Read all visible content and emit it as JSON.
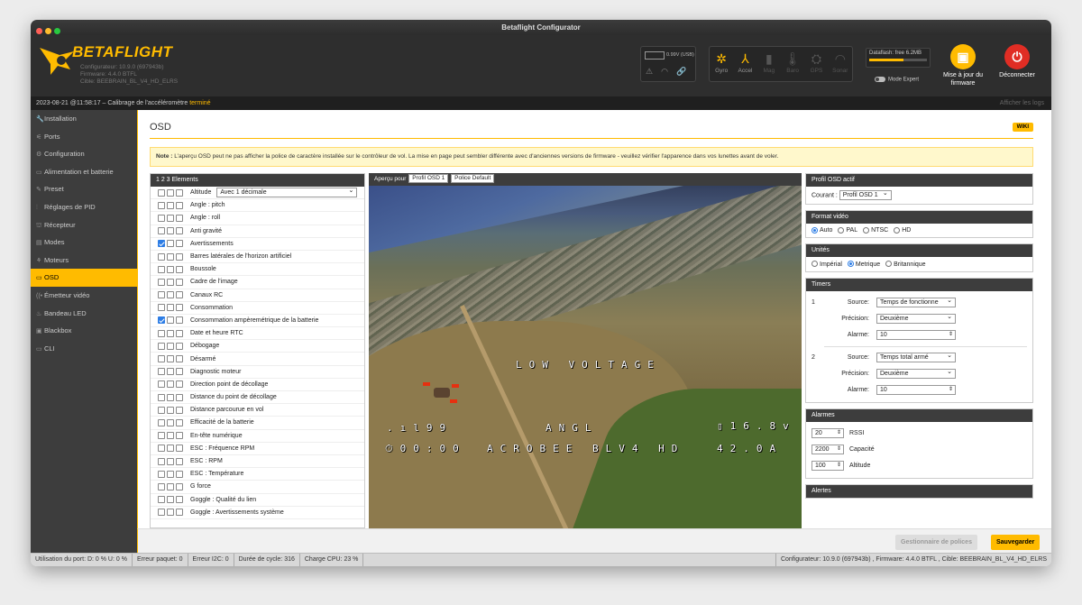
{
  "window": {
    "title": "Betaflight Configurator"
  },
  "header": {
    "logo_text": "BETAFLIGHT",
    "configurator": "Configurateur: 10.9.0 (697943b)",
    "firmware": "Firmware: 4.4.0 BTFL",
    "target": "Cible: BEEBRAIN_BL_V4_HD_ELRS",
    "battery": "0.99V (USB)",
    "sensors": [
      {
        "name": "Gyro",
        "icon": "✲",
        "state": "on"
      },
      {
        "name": "Accel",
        "icon": "⅄",
        "state": "on"
      },
      {
        "name": "Mag",
        "icon": "▮",
        "state": "off"
      },
      {
        "name": "Baro",
        "icon": "🌡",
        "state": "off"
      },
      {
        "name": "GPS",
        "icon": "⛭",
        "state": "off"
      },
      {
        "name": "Sonar",
        "icon": "◠",
        "state": "off"
      }
    ],
    "dataflash": "Dataflash: free 6.2MB",
    "dataflash_used_fraction": 0.6,
    "expert_mode": "Mode Expert",
    "update_firmware": "Mise à jour du firmware",
    "disconnect": "Déconnecter",
    "accent": "#ffbb00",
    "danger": "#e02d24"
  },
  "log": {
    "prefix": "2023-08-21 @11:58:17 – Calibrage de l'accéléromètre ",
    "done": "terminé",
    "show_logs": "Afficher les logs"
  },
  "nav": [
    {
      "label": "Installation",
      "icon": "🔧"
    },
    {
      "label": "Ports",
      "icon": "⚟"
    },
    {
      "label": "Configuration",
      "icon": "⚙"
    },
    {
      "label": "Alimentation et batterie",
      "icon": "▭"
    },
    {
      "label": "Preset",
      "icon": "✎"
    },
    {
      "label": "Réglages de PID",
      "icon": "⫶"
    },
    {
      "label": "Récepteur",
      "icon": "⛫"
    },
    {
      "label": "Modes",
      "icon": "▤"
    },
    {
      "label": "Moteurs",
      "icon": "⚘"
    },
    {
      "label": "OSD",
      "icon": "▭",
      "active": true
    },
    {
      "label": "Émetteur vidéo",
      "icon": "((•"
    },
    {
      "label": "Bandeau LED",
      "icon": "♨"
    },
    {
      "label": "Blackbox",
      "icon": "▣"
    },
    {
      "label": "CLI",
      "icon": "▭"
    }
  ],
  "osd": {
    "title": "OSD",
    "wiki": "WIKI",
    "note_bold": "Note :",
    "note": " L'aperçu OSD peut ne pas afficher la police de caractère installée sur le contrôleur de vol. La mise en page peut sembler différente avec d'anciennes versions de firmware - veuillez vérifier l'apparence dans vos lunettes avant de voler.",
    "elements_header": "1  2  3  Elements",
    "altitude_select": "Avec 1 décimale",
    "elements": [
      {
        "label": "Altitude",
        "c": [
          0,
          0,
          0
        ],
        "select": true
      },
      {
        "label": "Angle : pitch",
        "c": [
          0,
          0,
          0
        ]
      },
      {
        "label": "Angle : roll",
        "c": [
          0,
          0,
          0
        ]
      },
      {
        "label": "Anti gravité",
        "c": [
          0,
          0,
          0
        ]
      },
      {
        "label": "Avertissements",
        "c": [
          1,
          0,
          0
        ]
      },
      {
        "label": "Barres latérales de l'horizon artificiel",
        "c": [
          0,
          0,
          0
        ]
      },
      {
        "label": "Boussole",
        "c": [
          0,
          0,
          0
        ]
      },
      {
        "label": "Cadre de l'image",
        "c": [
          0,
          0,
          0
        ]
      },
      {
        "label": "Canaux RC",
        "c": [
          0,
          0,
          0
        ]
      },
      {
        "label": "Consommation",
        "c": [
          0,
          0,
          0
        ]
      },
      {
        "label": "Consommation ampèremétrique de la batterie",
        "c": [
          1,
          0,
          0
        ]
      },
      {
        "label": "Date et heure RTC",
        "c": [
          0,
          0,
          0
        ]
      },
      {
        "label": "Débogage",
        "c": [
          0,
          0,
          0
        ]
      },
      {
        "label": "Désarmé",
        "c": [
          0,
          0,
          0
        ]
      },
      {
        "label": "Diagnostic moteur",
        "c": [
          0,
          0,
          0
        ]
      },
      {
        "label": "Direction point de décollage",
        "c": [
          0,
          0,
          0
        ]
      },
      {
        "label": "Distance du point de décollage",
        "c": [
          0,
          0,
          0
        ]
      },
      {
        "label": "Distance parcourue en vol",
        "c": [
          0,
          0,
          0
        ]
      },
      {
        "label": "Efficacité de la batterie",
        "c": [
          0,
          0,
          0
        ]
      },
      {
        "label": "En-tête numérique",
        "c": [
          0,
          0,
          0
        ]
      },
      {
        "label": "ESC : Fréquence RPM",
        "c": [
          0,
          0,
          0
        ]
      },
      {
        "label": "ESC : RPM",
        "c": [
          0,
          0,
          0
        ]
      },
      {
        "label": "ESC : Température",
        "c": [
          0,
          0,
          0
        ]
      },
      {
        "label": "G force",
        "c": [
          0,
          0,
          0
        ]
      },
      {
        "label": "Goggle : Qualité du lien",
        "c": [
          0,
          0,
          0
        ]
      },
      {
        "label": "Goggle : Avertissements système",
        "c": [
          0,
          0,
          0
        ]
      }
    ],
    "preview_label": "Aperçu pour",
    "preview_profile": "Profil OSD 1",
    "preview_font": "Police Default",
    "overlay": {
      "warning": "LOW VOLTAGE",
      "rssi": "99",
      "angle": "ANGL",
      "voltage": "16.8v",
      "timer": "00:00",
      "craft": "ACROBEE BLV4 HD",
      "current": "42.0A"
    },
    "profile": {
      "title": "Profil OSD actif",
      "label": "Courant :",
      "value": "Profil OSD 1"
    },
    "video": {
      "title": "Format vidéo",
      "options": [
        "Auto",
        "PAL",
        "NTSC",
        "HD"
      ],
      "selected": "Auto"
    },
    "units": {
      "title": "Unités",
      "options": [
        "Impérial",
        "Metrique",
        "Britannique"
      ],
      "selected": "Metrique"
    },
    "timers": {
      "title": "Timers",
      "source_label": "Source:",
      "precision_label": "Précision:",
      "alarm_label": "Alarme:",
      "items": [
        {
          "num": "1",
          "source": "Temps de fonctionne",
          "precision": "Deuxième",
          "alarm": "10"
        },
        {
          "num": "2",
          "source": "Temps total armé",
          "precision": "Deuxième",
          "alarm": "10"
        }
      ]
    },
    "alarms": {
      "title": "Alarmes",
      "items": [
        {
          "value": "20",
          "label": "RSSI"
        },
        {
          "value": "2200",
          "label": "Capacité"
        },
        {
          "value": "100",
          "label": "Altitude"
        }
      ]
    },
    "alerts": {
      "title": "Alertes"
    },
    "font_manager": "Gestionnaire de polices",
    "save": "Sauvegarder"
  },
  "status": {
    "port": "Utilisation du port: D: 0 % U: 0 %",
    "packet": "Erreur paquet: 0",
    "i2c": "Erreur I2C: 0",
    "cycle": "Durée de cycle: 316",
    "cpu": "Charge CPU: 23 %",
    "version": "Configurateur: 10.9.0 (697943b) , Firmware: 4.4.0 BTFL , Cible: BEEBRAIN_BL_V4_HD_ELRS"
  }
}
